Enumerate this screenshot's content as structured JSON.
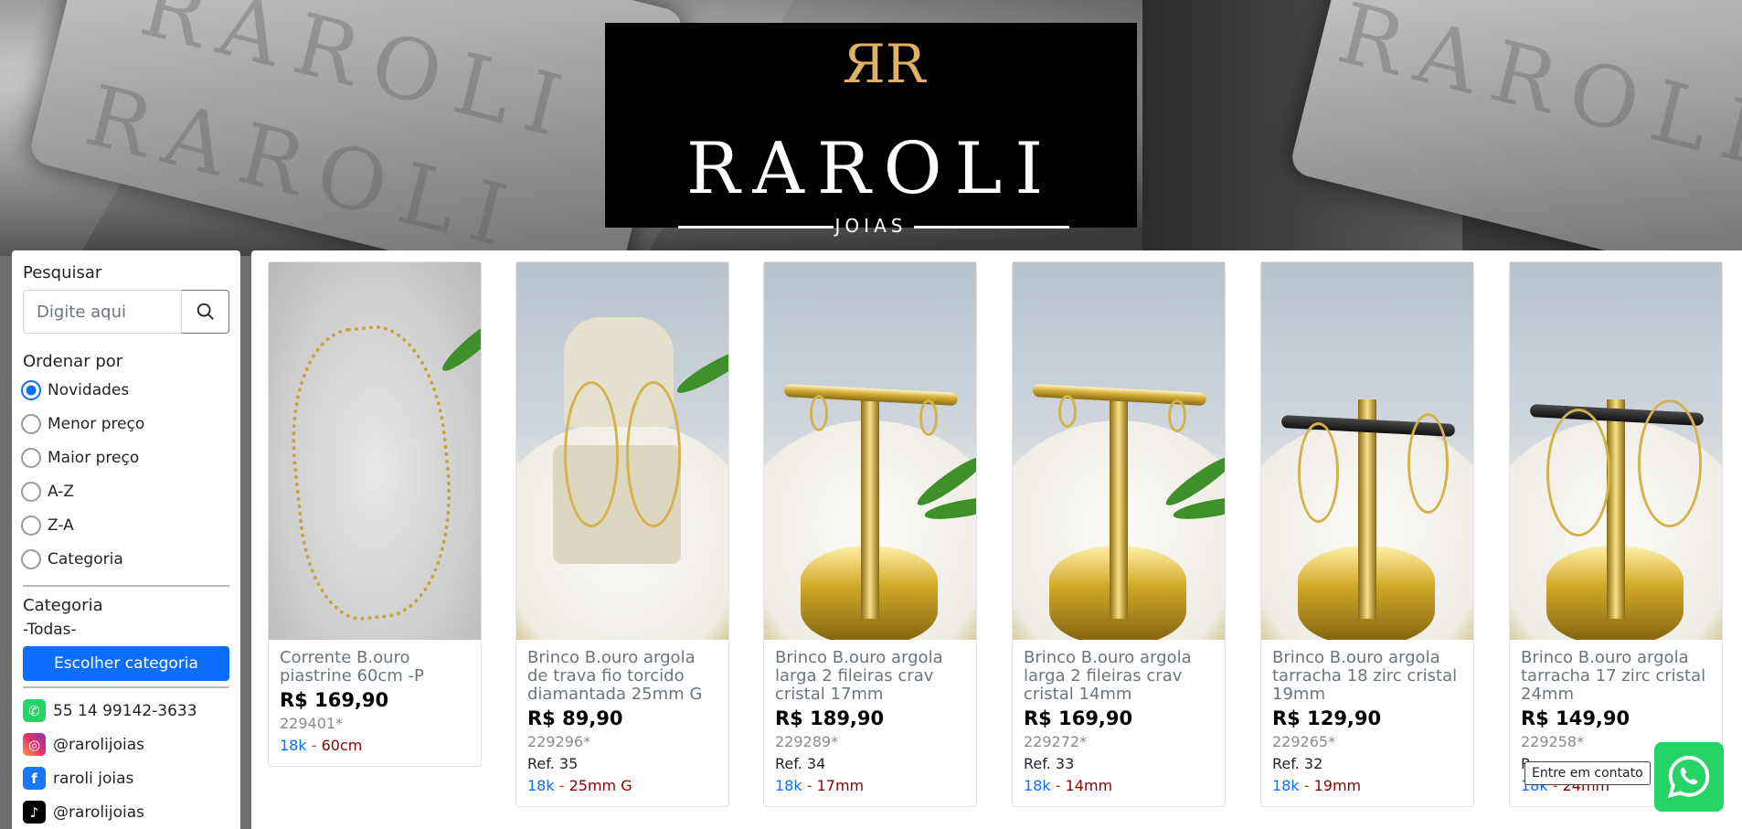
{
  "brand": {
    "name": "RAROLI",
    "subtitle": "JOIAS",
    "hero_text": "RAROLI"
  },
  "sidebar": {
    "search_heading": "Pesquisar",
    "search_placeholder": "Digite aqui",
    "sort_heading": "Ordenar por",
    "sort_options": [
      {
        "label": "Novidades",
        "checked": true
      },
      {
        "label": "Menor preço",
        "checked": false
      },
      {
        "label": "Maior preço",
        "checked": false
      },
      {
        "label": "A-Z",
        "checked": false
      },
      {
        "label": "Z-A",
        "checked": false
      },
      {
        "label": "Categoria",
        "checked": false
      }
    ],
    "category_heading": "Categoria",
    "category_value": "-Todas-",
    "category_button": "Escolher categoria",
    "contacts": [
      {
        "icon": "whatsapp-icon",
        "label": "55 14 99142-3633"
      },
      {
        "icon": "instagram-icon",
        "label": "@rarolijoias"
      },
      {
        "icon": "facebook-icon",
        "label": "raroli joias"
      },
      {
        "icon": "tiktok-icon",
        "label": "@rarolijoias"
      }
    ]
  },
  "products": [
    {
      "name": "Corrente B.ouro piastrine 60cm -P",
      "price": "R$ 169,90",
      "code": "229401*",
      "ref": "",
      "karat": "18k",
      "sep": " - ",
      "size": "60cm"
    },
    {
      "name": "Brinco B.ouro argola de trava fio torcido diamantada 25mm G",
      "price": "R$ 89,90",
      "code": "229296*",
      "ref": "Ref. 35",
      "karat": "18k",
      "sep": " - ",
      "size": "25mm G"
    },
    {
      "name": "Brinco B.ouro argola larga 2 fileiras crav cristal 17mm",
      "price": "R$ 189,90",
      "code": "229289*",
      "ref": "Ref. 34",
      "karat": "18k",
      "sep": " - ",
      "size": "17mm"
    },
    {
      "name": "Brinco B.ouro argola larga 2 fileiras crav cristal 14mm",
      "price": "R$ 169,90",
      "code": "229272*",
      "ref": "Ref. 33",
      "karat": "18k",
      "sep": " - ",
      "size": "14mm"
    },
    {
      "name": "Brinco B.ouro argola tarracha 18 zirc cristal 19mm",
      "price": "R$ 129,90",
      "code": "229265*",
      "ref": "Ref. 32",
      "karat": "18k",
      "sep": " - ",
      "size": "19mm"
    },
    {
      "name": "Brinco B.ouro argola tarracha 17 zirc cristal 24mm",
      "price": "R$ 149,90",
      "code": "229258*",
      "ref": "R",
      "karat": "18k",
      "sep": " - ",
      "size": "24mm"
    }
  ],
  "whatsapp": {
    "tooltip": "Entre em contato"
  },
  "colors": {
    "accent": "#0d6efd",
    "whatsapp": "#25d366",
    "gold": "#e0b067"
  }
}
